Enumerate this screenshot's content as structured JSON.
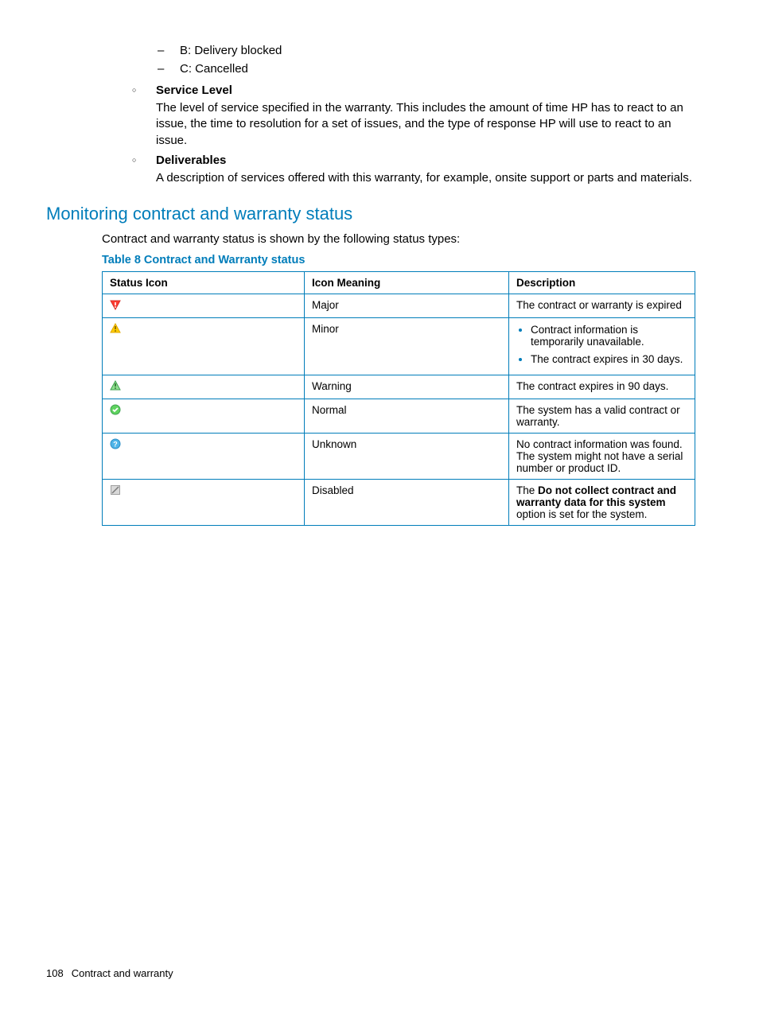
{
  "dashes": [
    "B: Delivery blocked",
    "C: Cancelled"
  ],
  "circle_items": [
    {
      "title": "Service Level",
      "body": "The level of service specified in the warranty. This includes the amount of time HP has to react to an issue, the time to resolution for a set of issues, and the type of response HP will use to react to an issue."
    },
    {
      "title": "Deliverables",
      "body": "A description of services offered with this warranty, for example, onsite support or parts and materials."
    }
  ],
  "section_heading": "Monitoring contract and warranty status",
  "intro": "Contract and warranty status is shown by the following status types:",
  "table_caption": "Table 8 Contract and Warranty status",
  "table": {
    "headers": [
      "Status Icon",
      "Icon Meaning",
      "Description"
    ],
    "rows": [
      {
        "icon": "major",
        "meaning": "Major",
        "desc_plain": "The contract or warranty is expired"
      },
      {
        "icon": "minor",
        "meaning": "Minor",
        "desc_bullets": [
          "Contract information is temporarily unavailable.",
          "The contract expires in 30 days."
        ]
      },
      {
        "icon": "warning",
        "meaning": "Warning",
        "desc_plain": "The contract expires in 90 days."
      },
      {
        "icon": "normal",
        "meaning": "Normal",
        "desc_plain": "The system has a valid contract or warranty."
      },
      {
        "icon": "unknown",
        "meaning": "Unknown",
        "desc_plain": "No contract information was found. The system might not have a serial number or product ID."
      },
      {
        "icon": "disabled",
        "meaning": "Disabled",
        "desc_rich": {
          "prefix": "The ",
          "bold": "Do not collect contract and warranty data for this system",
          "suffix": " option is set for the system."
        }
      }
    ]
  },
  "footer": {
    "page_number": "108",
    "section": "Contract and warranty"
  }
}
